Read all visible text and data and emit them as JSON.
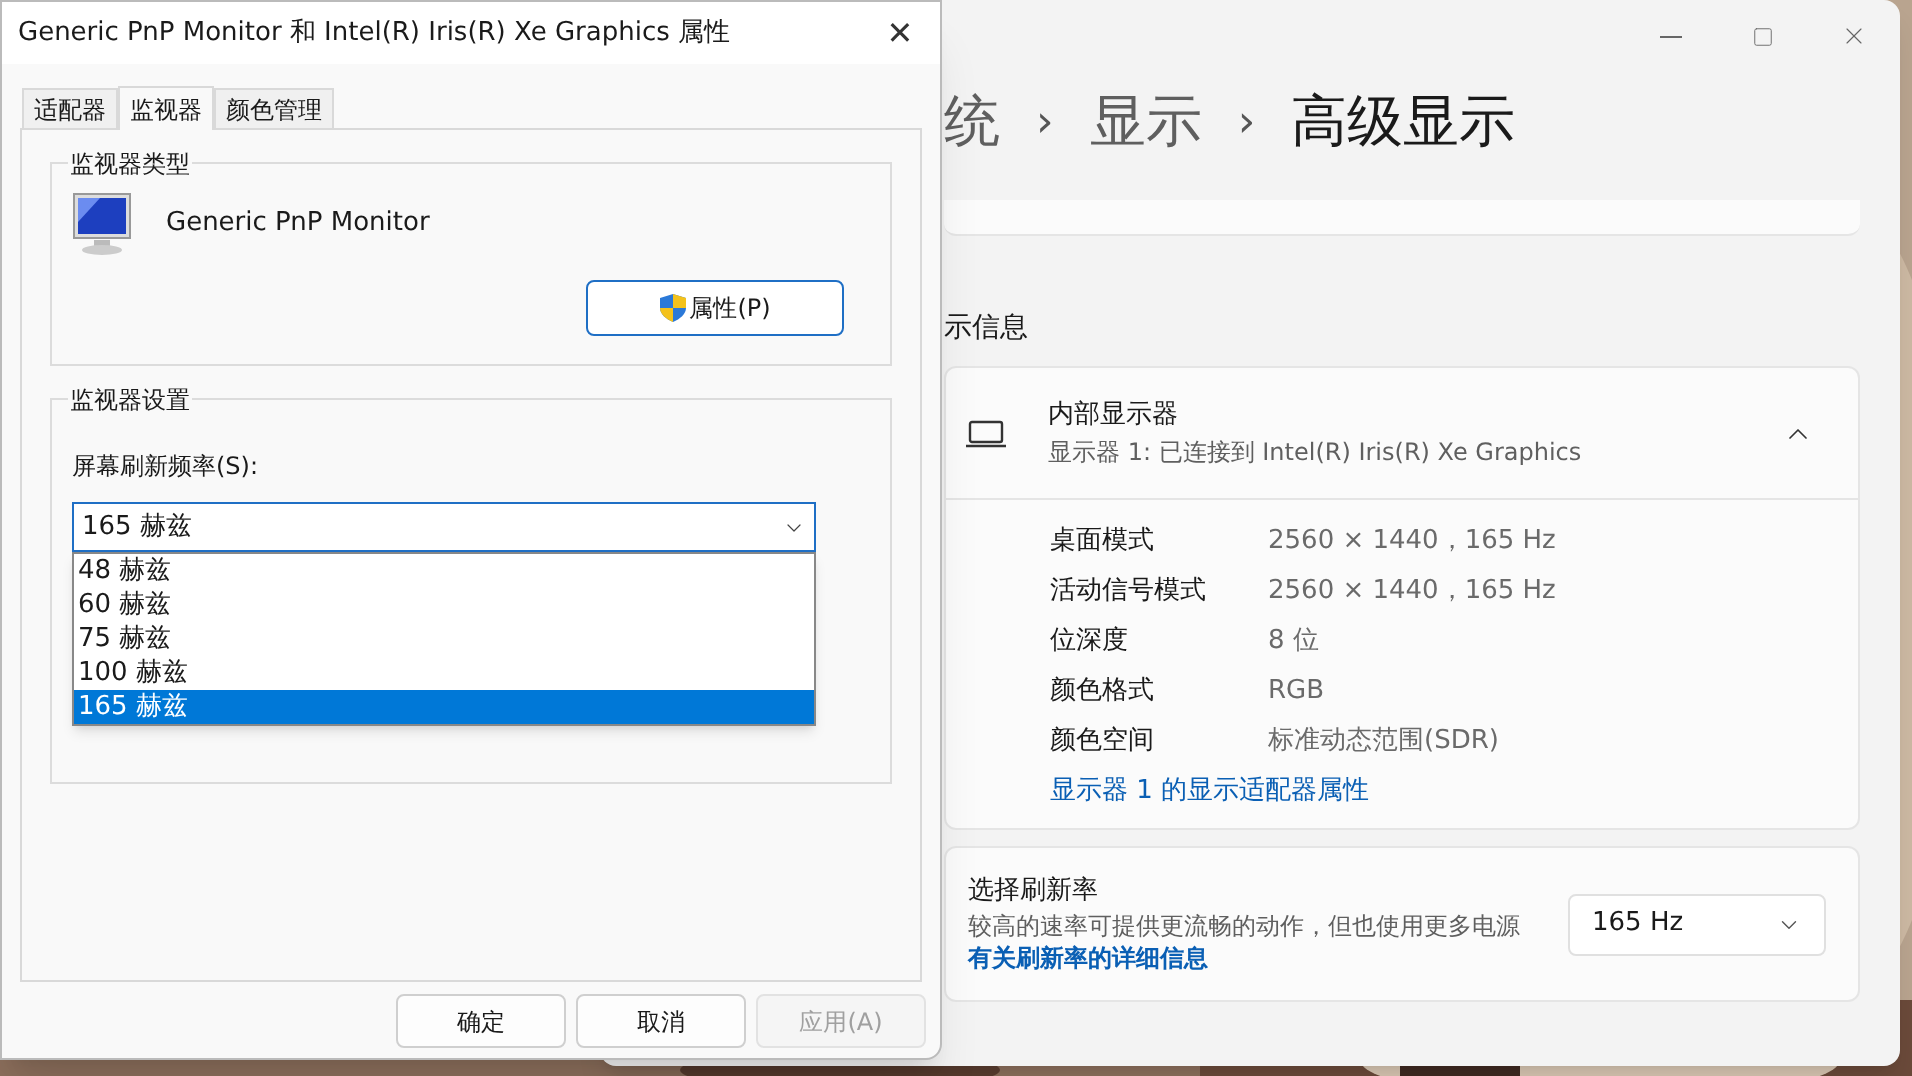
{
  "settings_window": {
    "breadcrumb": [
      {
        "label": "统",
        "current": false
      },
      {
        "label": "显示",
        "current": false
      },
      {
        "label": "高级显示",
        "current": true
      }
    ],
    "separator": "›",
    "section_title": "示信息",
    "display_card": {
      "name": "内部显示器",
      "subtitle": "显示器 1: 已连接到 Intel(R) Iris(R) Xe Graphics",
      "expanded": true,
      "rows": [
        {
          "label": "桌面模式",
          "value": "2560 × 1440，165 Hz"
        },
        {
          "label": "活动信号模式",
          "value": "2560 × 1440，165 Hz"
        },
        {
          "label": "位深度",
          "value": "8 位"
        },
        {
          "label": "颜色格式",
          "value": "RGB"
        },
        {
          "label": "颜色空间",
          "value": "标准动态范围(SDR)"
        }
      ],
      "link": "显示器 1 的显示适配器属性"
    },
    "refresh_card": {
      "title": "选择刷新率",
      "description": "较高的速率可提供更流畅的动作，但也使用更多电源",
      "link": "有关刷新率的详细信息",
      "value": "165 Hz"
    }
  },
  "dialog": {
    "title": "Generic PnP Monitor 和 Intel(R) Iris(R) Xe Graphics 属性",
    "close": "✕",
    "tabs": [
      {
        "label": "适配器",
        "selected": false
      },
      {
        "label": "监视器",
        "selected": true
      },
      {
        "label": "颜色管理",
        "selected": false
      }
    ],
    "monitor_type": {
      "legend": "监视器类型",
      "name": "Generic PnP Monitor",
      "button": "属性(P)"
    },
    "monitor_settings": {
      "legend": "监视器设置",
      "field_label": "屏幕刷新频率(S):",
      "value": "165 赫兹",
      "options": [
        {
          "label": "48 赫兹",
          "selected": false
        },
        {
          "label": "60 赫兹",
          "selected": false
        },
        {
          "label": "75 赫兹",
          "selected": false
        },
        {
          "label": "100 赫兹",
          "selected": false
        },
        {
          "label": "165 赫兹",
          "selected": true
        }
      ]
    },
    "buttons": [
      {
        "label": "确定",
        "disabled": false
      },
      {
        "label": "取消",
        "disabled": false
      },
      {
        "label": "应用(A)",
        "disabled": true
      }
    ]
  }
}
